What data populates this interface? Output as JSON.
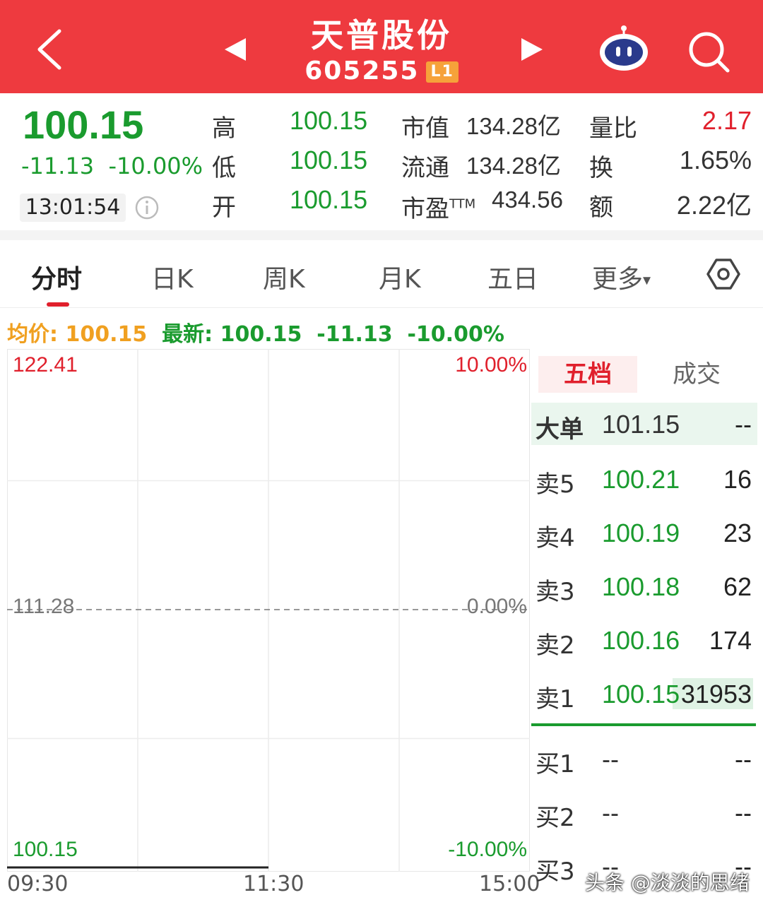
{
  "header": {
    "title": "天普股份",
    "code": "605255",
    "level_badge": "L1",
    "icons": [
      "back-arrow-icon",
      "prev-stock-icon",
      "next-stock-icon",
      "robot-assistant-icon",
      "search-icon"
    ]
  },
  "quote": {
    "price": "100.15",
    "change": "-11.13",
    "change_pct": "-10.00%",
    "time": "13:01:54",
    "high_label": "高",
    "high": "100.15",
    "low_label": "低",
    "low": "100.15",
    "open_label": "开",
    "open": "100.15",
    "mktcap_label": "市值",
    "mktcap": "134.28亿",
    "float_label": "流通",
    "float": "134.28亿",
    "pe_label": "市盈",
    "pe_sup": "TTM",
    "pe": "434.56",
    "volratio_label": "量比",
    "volratio": "2.17",
    "turnover_label": "换",
    "turnover": "1.65%",
    "amount_label": "额",
    "amount": "2.22亿"
  },
  "tabs": [
    "分时",
    "日K",
    "周K",
    "月K",
    "五日",
    "更多"
  ],
  "legend": {
    "avg_label": "均价:",
    "avg": "100.15",
    "latest_label": "最新:",
    "latest": "100.15",
    "change": "-11.13",
    "change_pct": "-10.00%"
  },
  "chart_data": {
    "type": "line",
    "title": "",
    "y_left_ticks": [
      "122.41",
      "111.28",
      "100.15"
    ],
    "y_right_ticks": [
      "10.00%",
      "0.00%",
      "-10.00%"
    ],
    "x_ticks": [
      "09:30",
      "11:30",
      "15:00"
    ],
    "ylim": [
      100.15,
      122.41
    ],
    "prev_close": 111.28,
    "series": [
      {
        "x": [
          "09:30",
          "11:30"
        ],
        "values": [
          100.15,
          100.15
        ]
      }
    ],
    "grid": true
  },
  "orderbook": {
    "tab_active": "五档",
    "tab_other": "成交",
    "big_order": {
      "label": "大单",
      "price": "101.15",
      "vol": "--"
    },
    "asks": [
      {
        "label": "卖5",
        "price": "100.21",
        "vol": "16"
      },
      {
        "label": "卖4",
        "price": "100.19",
        "vol": "23"
      },
      {
        "label": "卖3",
        "price": "100.18",
        "vol": "62"
      },
      {
        "label": "卖2",
        "price": "100.16",
        "vol": "174"
      },
      {
        "label": "卖1",
        "price": "100.15",
        "vol": "31953"
      }
    ],
    "bids": [
      {
        "label": "买1",
        "price": "--",
        "vol": "--"
      },
      {
        "label": "买2",
        "price": "--",
        "vol": "--"
      },
      {
        "label": "买3",
        "price": "--",
        "vol": "--"
      }
    ]
  },
  "watermark": "头条 @淡淡的思绪",
  "colors": {
    "header_red": "#ee3a3f",
    "down_green": "#1a9b2e",
    "up_red": "#e0202c",
    "avg_orange": "#f0a020"
  }
}
